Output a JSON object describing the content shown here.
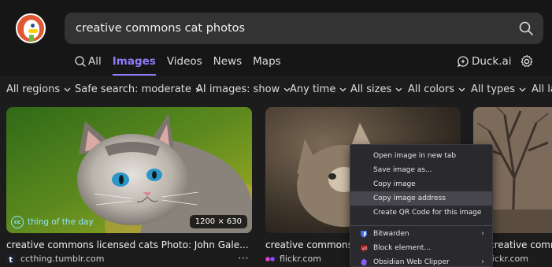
{
  "search": {
    "query": "creative commons cat photos"
  },
  "tabs": [
    {
      "label": "All"
    },
    {
      "label": "Images"
    },
    {
      "label": "Videos"
    },
    {
      "label": "News"
    },
    {
      "label": "Maps"
    }
  ],
  "duck_ai_label": "Duck.ai",
  "filters": [
    {
      "label": "All regions"
    },
    {
      "label": "Safe search: moderate"
    },
    {
      "label": "AI images: show"
    },
    {
      "label": "Any time"
    },
    {
      "label": "All sizes"
    },
    {
      "label": "All colors"
    },
    {
      "label": "All types"
    },
    {
      "label": "All la"
    }
  ],
  "results": [
    {
      "caption": "creative commons licensed cats Photo: John Gale... : Creat...",
      "source": "ccthing.tumblr.com",
      "dimensions": "1200 × 630",
      "watermark": "thing of the day",
      "watermark_cc": "cc"
    },
    {
      "caption": "creative commons c",
      "source": "flickr.com"
    },
    {
      "caption": "creative commons",
      "source": "ickr.com"
    }
  ],
  "more_menu": "⋯",
  "context_menu": {
    "items": [
      {
        "label": "Open image in new tab"
      },
      {
        "label": "Save image as..."
      },
      {
        "label": "Copy image"
      },
      {
        "label": "Copy image address"
      },
      {
        "label": "Create QR Code for this image"
      }
    ],
    "extensions": [
      {
        "label": "Bitwarden"
      },
      {
        "label": "Block element..."
      },
      {
        "label": "Obsidian Web Clipper"
      }
    ]
  },
  "colors": {
    "accent": "#8f7bf6",
    "logo": "#de5833",
    "highlight": "#46464c"
  }
}
